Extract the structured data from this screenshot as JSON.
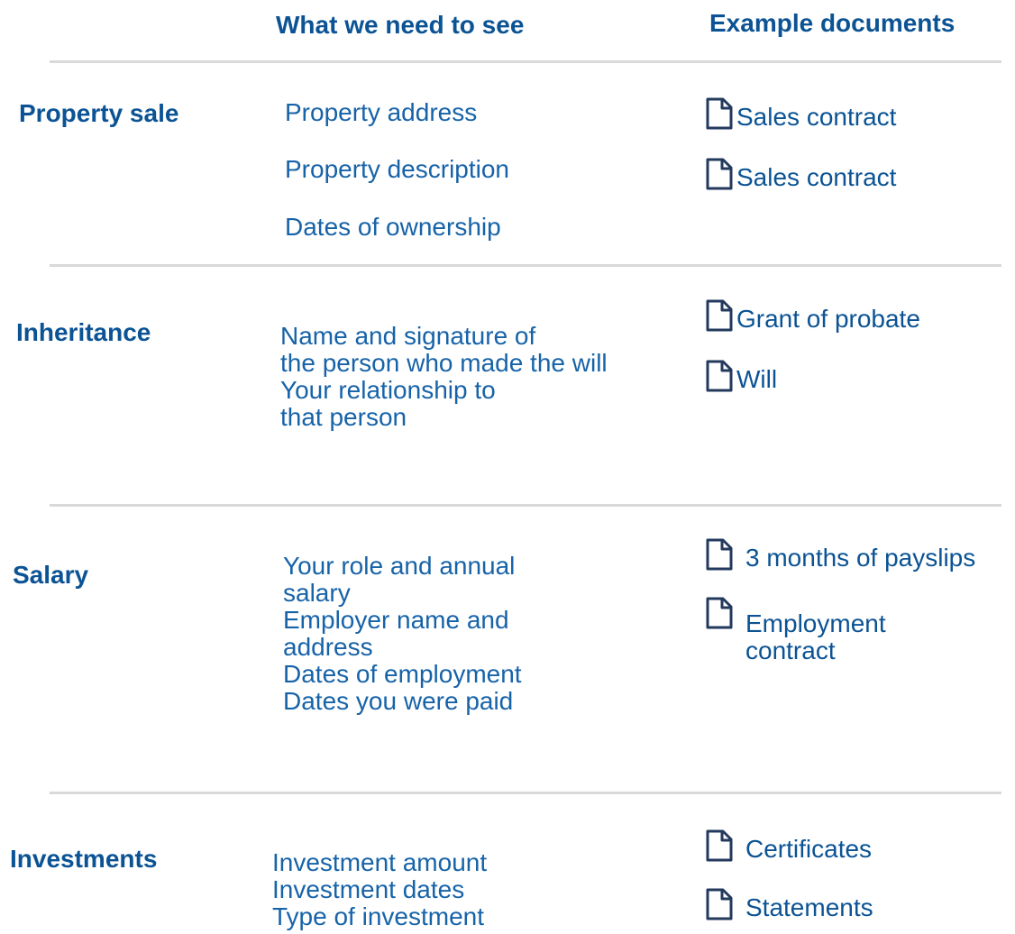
{
  "header": {
    "need_label": "What we need to see",
    "docs_label": "Example documents"
  },
  "sections": [
    {
      "category": "Property sale",
      "requirements": [
        "Property address",
        "Property description",
        "Dates of ownership"
      ],
      "documents": [
        "Sales contract",
        "Sales contract"
      ]
    },
    {
      "category": "Inheritance",
      "requirements": [
        "Name and signature of",
        "the person who made the will",
        "Your relationship to",
        "that person"
      ],
      "documents": [
        "Grant of probate",
        "Will"
      ]
    },
    {
      "category": "Salary",
      "requirements": [
        "Your role and annual",
        "salary",
        "Employer name and",
        "address",
        "Dates of employment",
        "Dates you were paid"
      ],
      "documents": [
        "3 months of payslips",
        "Employment contract"
      ]
    },
    {
      "category": "Investments",
      "requirements": [
        "Investment amount",
        "Investment dates",
        "Type of investment"
      ],
      "documents": [
        "Certificates",
        "Statements"
      ]
    }
  ],
  "icons": {
    "document": "document-icon"
  },
  "colors": {
    "heading": "#0b5394",
    "text": "#1763a8",
    "divider": "#d9d9d9",
    "icon_stroke": "#233a5e"
  }
}
